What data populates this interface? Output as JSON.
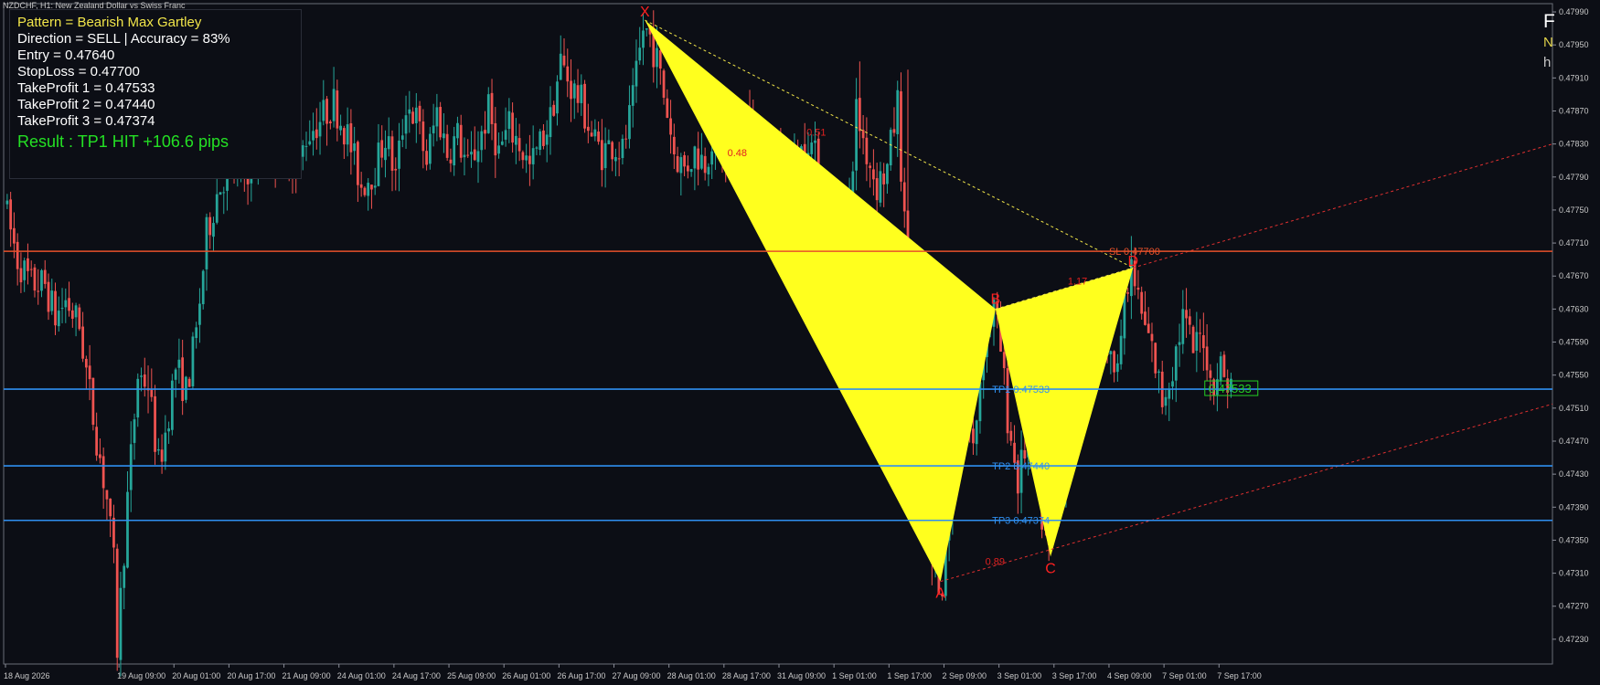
{
  "chart_title": "NZDCHF, H1:  New Zealand Dollar vs Swiss Franc",
  "info_panel": {
    "pattern": "Pattern = Bearish Max Gartley",
    "direction": "Direction = SELL   |   Accuracy = 83%",
    "entry": "Entry = 0.47640",
    "stop_loss": "StopLoss = 0.47700",
    "take_profit_1": "TakeProfit 1 = 0.47533",
    "take_profit_2": "TakeProfit 2 = 0.47440",
    "take_profit_3": "TakeProfit 3 = 0.47374",
    "result": "Result : TP1 HIT    +106.6 pips"
  },
  "corner_text": {
    "line1": "F",
    "line2": "N",
    "line3": "h"
  },
  "colors": {
    "background": "#0c0e15",
    "bull": "#26a69a",
    "bear": "#ef5350",
    "pattern_fill": "#ffff1e",
    "sl_line": "#e8512a",
    "tp_line": "#2f8ff0",
    "pattern_label": "#ff2020"
  },
  "chart_data": {
    "type": "candlestick",
    "symbol": "NZDCHF",
    "timeframe": "H1",
    "y_axis": {
      "min": 0.472,
      "max": 0.48,
      "ticks": [
        "0.47990",
        "0.47950",
        "0.47910",
        "0.47870",
        "0.47830",
        "0.47790",
        "0.47750",
        "0.47710",
        "0.47670",
        "0.47630",
        "0.47590",
        "0.47550",
        "0.47510",
        "0.47470",
        "0.47430",
        "0.47390",
        "0.47350",
        "0.47310",
        "0.47270",
        "0.47230"
      ]
    },
    "x_axis": {
      "first_bar": "18 Aug 2026",
      "last_bar": "7 Sep 20:00",
      "ticks": [
        {
          "label": "18 Aug 2026",
          "bar": 0
        },
        {
          "label": "19 Aug 09:00",
          "bar": 33
        },
        {
          "label": "20 Aug 01:00",
          "bar": 49
        },
        {
          "label": "20 Aug 17:00",
          "bar": 65
        },
        {
          "label": "21 Aug 09:00",
          "bar": 81
        },
        {
          "label": "24 Aug 01:00",
          "bar": 97
        },
        {
          "label": "24 Aug 17:00",
          "bar": 113
        },
        {
          "label": "25 Aug 09:00",
          "bar": 129
        },
        {
          "label": "26 Aug 01:00",
          "bar": 145
        },
        {
          "label": "26 Aug 17:00",
          "bar": 161
        },
        {
          "label": "27 Aug 09:00",
          "bar": 177
        },
        {
          "label": "28 Aug 01:00",
          "bar": 193
        },
        {
          "label": "28 Aug 17:00",
          "bar": 209
        },
        {
          "label": "31 Aug 09:00",
          "bar": 225
        },
        {
          "label": "1 Sep 01:00",
          "bar": 241
        },
        {
          "label": "1 Sep 17:00",
          "bar": 257
        },
        {
          "label": "2 Sep 09:00",
          "bar": 273
        },
        {
          "label": "3 Sep 01:00",
          "bar": 289
        },
        {
          "label": "3 Sep 17:00",
          "bar": 305
        },
        {
          "label": "4 Sep 09:00",
          "bar": 321
        },
        {
          "label": "7 Sep 01:00",
          "bar": 337
        },
        {
          "label": "7 Sep 17:00",
          "bar": 353
        }
      ]
    },
    "price_path": [
      [
        0,
        0.4776
      ],
      [
        4,
        0.4769
      ],
      [
        8,
        0.4766
      ],
      [
        12,
        0.4766
      ],
      [
        15,
        0.4762
      ],
      [
        18,
        0.4764
      ],
      [
        22,
        0.4761
      ],
      [
        26,
        0.475
      ],
      [
        30,
        0.474
      ],
      [
        32,
        0.4732
      ],
      [
        33,
        0.4722
      ],
      [
        36,
        0.474
      ],
      [
        39,
        0.4755
      ],
      [
        42,
        0.4754
      ],
      [
        45,
        0.4744
      ],
      [
        47,
        0.4748
      ],
      [
        50,
        0.4756
      ],
      [
        53,
        0.4753
      ],
      [
        56,
        0.476
      ],
      [
        59,
        0.4772
      ],
      [
        62,
        0.4777
      ],
      [
        65,
        0.478
      ],
      [
        68,
        0.478
      ],
      [
        72,
        0.478
      ],
      [
        75,
        0.4783
      ],
      [
        79,
        0.4782
      ],
      [
        82,
        0.4784
      ],
      [
        85,
        0.4779
      ],
      [
        88,
        0.4784
      ],
      [
        92,
        0.4786
      ],
      [
        96,
        0.4788
      ],
      [
        100,
        0.4784
      ],
      [
        104,
        0.4778
      ],
      [
        108,
        0.478
      ],
      [
        111,
        0.4784
      ],
      [
        114,
        0.4779
      ],
      [
        117,
        0.4788
      ],
      [
        120,
        0.4786
      ],
      [
        123,
        0.4781
      ],
      [
        126,
        0.4787
      ],
      [
        129,
        0.4782
      ],
      [
        132,
        0.4784
      ],
      [
        135,
        0.478
      ],
      [
        138,
        0.4783
      ],
      [
        141,
        0.4787
      ],
      [
        144,
        0.4782
      ],
      [
        147,
        0.4785
      ],
      [
        150,
        0.4783
      ],
      [
        153,
        0.478
      ],
      [
        156,
        0.4783
      ],
      [
        159,
        0.4786
      ],
      [
        162,
        0.4793
      ],
      [
        165,
        0.479
      ],
      [
        168,
        0.4788
      ],
      [
        171,
        0.4784
      ],
      [
        174,
        0.4782
      ],
      [
        177,
        0.4783
      ],
      [
        180,
        0.4782
      ],
      [
        183,
        0.4788
      ],
      [
        186,
        0.4797
      ],
      [
        188,
        0.4796
      ],
      [
        190,
        0.4793
      ],
      [
        193,
        0.4787
      ],
      [
        195,
        0.4782
      ],
      [
        198,
        0.478
      ],
      [
        201,
        0.4782
      ],
      [
        204,
        0.4781
      ],
      [
        207,
        0.4785
      ],
      [
        210,
        0.478
      ],
      [
        213,
        0.4786
      ],
      [
        216,
        0.4787
      ],
      [
        219,
        0.4783
      ],
      [
        222,
        0.4778
      ],
      [
        225,
        0.4782
      ],
      [
        228,
        0.4779
      ],
      [
        231,
        0.4781
      ],
      [
        234,
        0.4784
      ],
      [
        237,
        0.478
      ],
      [
        240,
        0.4774
      ],
      [
        243,
        0.4772
      ],
      [
        246,
        0.4776
      ],
      [
        248,
        0.4787
      ],
      [
        251,
        0.4782
      ],
      [
        254,
        0.4778
      ],
      [
        257,
        0.478
      ],
      [
        260,
        0.4788
      ],
      [
        262,
        0.4773
      ],
      [
        264,
        0.4738
      ],
      [
        267,
        0.4742
      ],
      [
        270,
        0.4732
      ],
      [
        273,
        0.473
      ],
      [
        276,
        0.4743
      ],
      [
        279,
        0.4752
      ],
      [
        282,
        0.4746
      ],
      [
        285,
        0.4759
      ],
      [
        288,
        0.4763
      ],
      [
        290,
        0.4758
      ],
      [
        292,
        0.475
      ],
      [
        295,
        0.4742
      ],
      [
        298,
        0.4748
      ],
      [
        301,
        0.474
      ],
      [
        304,
        0.4733
      ],
      [
        307,
        0.474
      ],
      [
        310,
        0.4748
      ],
      [
        313,
        0.4753
      ],
      [
        316,
        0.476
      ],
      [
        319,
        0.4764
      ],
      [
        322,
        0.4756
      ],
      [
        325,
        0.476
      ],
      [
        328,
        0.4768
      ],
      [
        331,
        0.4762
      ],
      [
        334,
        0.4758
      ],
      [
        337,
        0.4752
      ],
      [
        340,
        0.4756
      ],
      [
        343,
        0.4762
      ],
      [
        346,
        0.4758
      ],
      [
        349,
        0.476
      ],
      [
        351,
        0.4754
      ],
      [
        354,
        0.4756
      ],
      [
        356,
        0.4754
      ]
    ],
    "pattern": {
      "name": "Bearish Max Gartley",
      "points": [
        {
          "label": "X",
          "bar": 186,
          "price": 0.4798
        },
        {
          "label": "A",
          "bar": 272,
          "price": 0.473
        },
        {
          "label": "B",
          "bar": 288,
          "price": 0.4763
        },
        {
          "label": "C",
          "bar": 304,
          "price": 0.4733
        },
        {
          "label": "D",
          "bar": 328,
          "price": 0.4768
        }
      ],
      "ratios": [
        {
          "label": "0.48",
          "bar": 210,
          "price": 0.47815
        },
        {
          "label": "0.51",
          "bar": 233,
          "price": 0.4784
        },
        {
          "label": "1.17",
          "bar": 309,
          "price": 0.4766
        },
        {
          "label": "0.89",
          "bar": 285,
          "price": 0.4732
        }
      ]
    },
    "levels": [
      {
        "label": "SL 0.47700",
        "value": 0.477,
        "kind": "sl"
      },
      {
        "label": "TP1 0.47533",
        "value": 0.47533,
        "kind": "tp"
      },
      {
        "label": "TP2 0.47440",
        "value": 0.4744,
        "kind": "tp"
      },
      {
        "label": "TP3 0.47374",
        "value": 0.47374,
        "kind": "tp"
      }
    ],
    "tp_badge": {
      "label": "0.47533",
      "bar": 351,
      "value": 0.47533
    }
  }
}
